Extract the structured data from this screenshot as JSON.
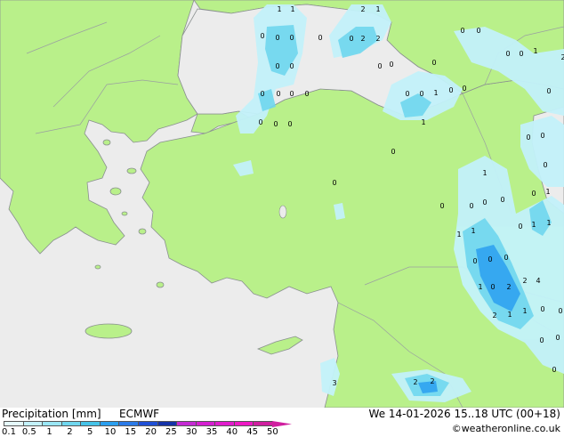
{
  "legend": {
    "title": "Precipitation [mm]",
    "model": "ECMWF",
    "ticks": [
      "0.1",
      "0.5",
      "1",
      "2",
      "5",
      "10",
      "15",
      "20",
      "25",
      "30",
      "35",
      "40",
      "45",
      "50"
    ],
    "colors": [
      "#e6fafd",
      "#c3f2fa",
      "#9ae7f5",
      "#6fd7ef",
      "#45c3e8",
      "#2a9ff0",
      "#2a7ae8",
      "#1f4fd6",
      "#1432a8",
      "#c52ad4",
      "#d51fd1",
      "#e11ccd",
      "#ee18c4",
      "#d01f9f"
    ]
  },
  "valid_time": "We 14-01-2026 15..18 UTC (00+18)",
  "credit": "©weatheronline.co.uk",
  "map": {
    "colors": {
      "sea": "#ececec",
      "land": "#b9f08a",
      "border": "#9aa0a0",
      "coast": "#8a9090"
    },
    "values": [
      "1",
      "1",
      "2",
      "1",
      "0",
      "0",
      "0",
      "0",
      "0",
      "2",
      "2",
      "0",
      "0",
      "0",
      "0",
      "0",
      "0",
      "0",
      "1",
      "2",
      "0",
      "0",
      "0",
      "0",
      "0",
      "0",
      "0",
      "0",
      "1",
      "0",
      "0",
      "0",
      "0",
      "0",
      "0",
      "0",
      "1",
      "0",
      "0",
      "0",
      "0",
      "0",
      "1",
      "0",
      "0",
      "0",
      "0",
      "1",
      "0",
      "1",
      "1",
      "1",
      "1",
      "0",
      "0",
      "0",
      "2",
      "4",
      "1",
      "0",
      "2",
      "1",
      "0",
      "0",
      "2",
      "1",
      "0",
      "0",
      "0",
      "2",
      "2",
      "3",
      "1",
      "1",
      "0",
      "2",
      "2",
      "1",
      "1",
      "1",
      "0",
      "0",
      "1",
      "1",
      "2"
    ]
  }
}
